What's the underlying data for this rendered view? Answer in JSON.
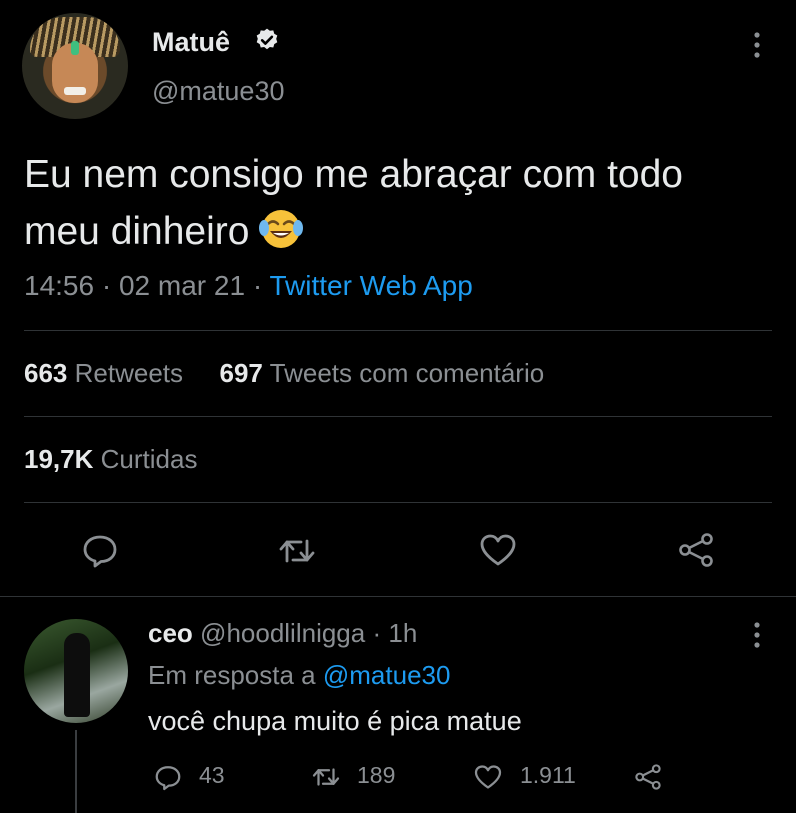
{
  "tweet": {
    "author_name": "Matuê",
    "author_handle": "@matue30",
    "text_line1": "Eu nem consigo me abraçar com todo",
    "text_line2": "meu dinheiro",
    "emoji": "face-with-tears-of-joy",
    "time": "14:56",
    "dot1": "·",
    "date": "02 mar 21",
    "dot2": "·",
    "source": "Twitter Web App",
    "retweets_count": "663",
    "retweets_label": "Retweets",
    "quotes_count": "697",
    "quotes_label": "Tweets com comentário",
    "likes_count": "19,7K",
    "likes_label": "Curtidas"
  },
  "actions": {
    "icons": [
      "reply-icon",
      "retweet-icon",
      "like-icon",
      "share-icon"
    ]
  },
  "reply": {
    "author_name": "ceo",
    "author_handle": "@hoodlilnigga",
    "dot": "·",
    "time": "1h",
    "reply_to_label": "Em resposta a",
    "reply_to_handle": "@matue30",
    "text": "você chupa muito é pica matue",
    "replies": "43",
    "retweets": "189",
    "likes": "1.911"
  },
  "colors": {
    "background": "#000000",
    "accent": "#1d9bf0",
    "secondary_text": "#8b8f93",
    "primary_text": "#e7e9ea",
    "divider": "#2f3336"
  }
}
